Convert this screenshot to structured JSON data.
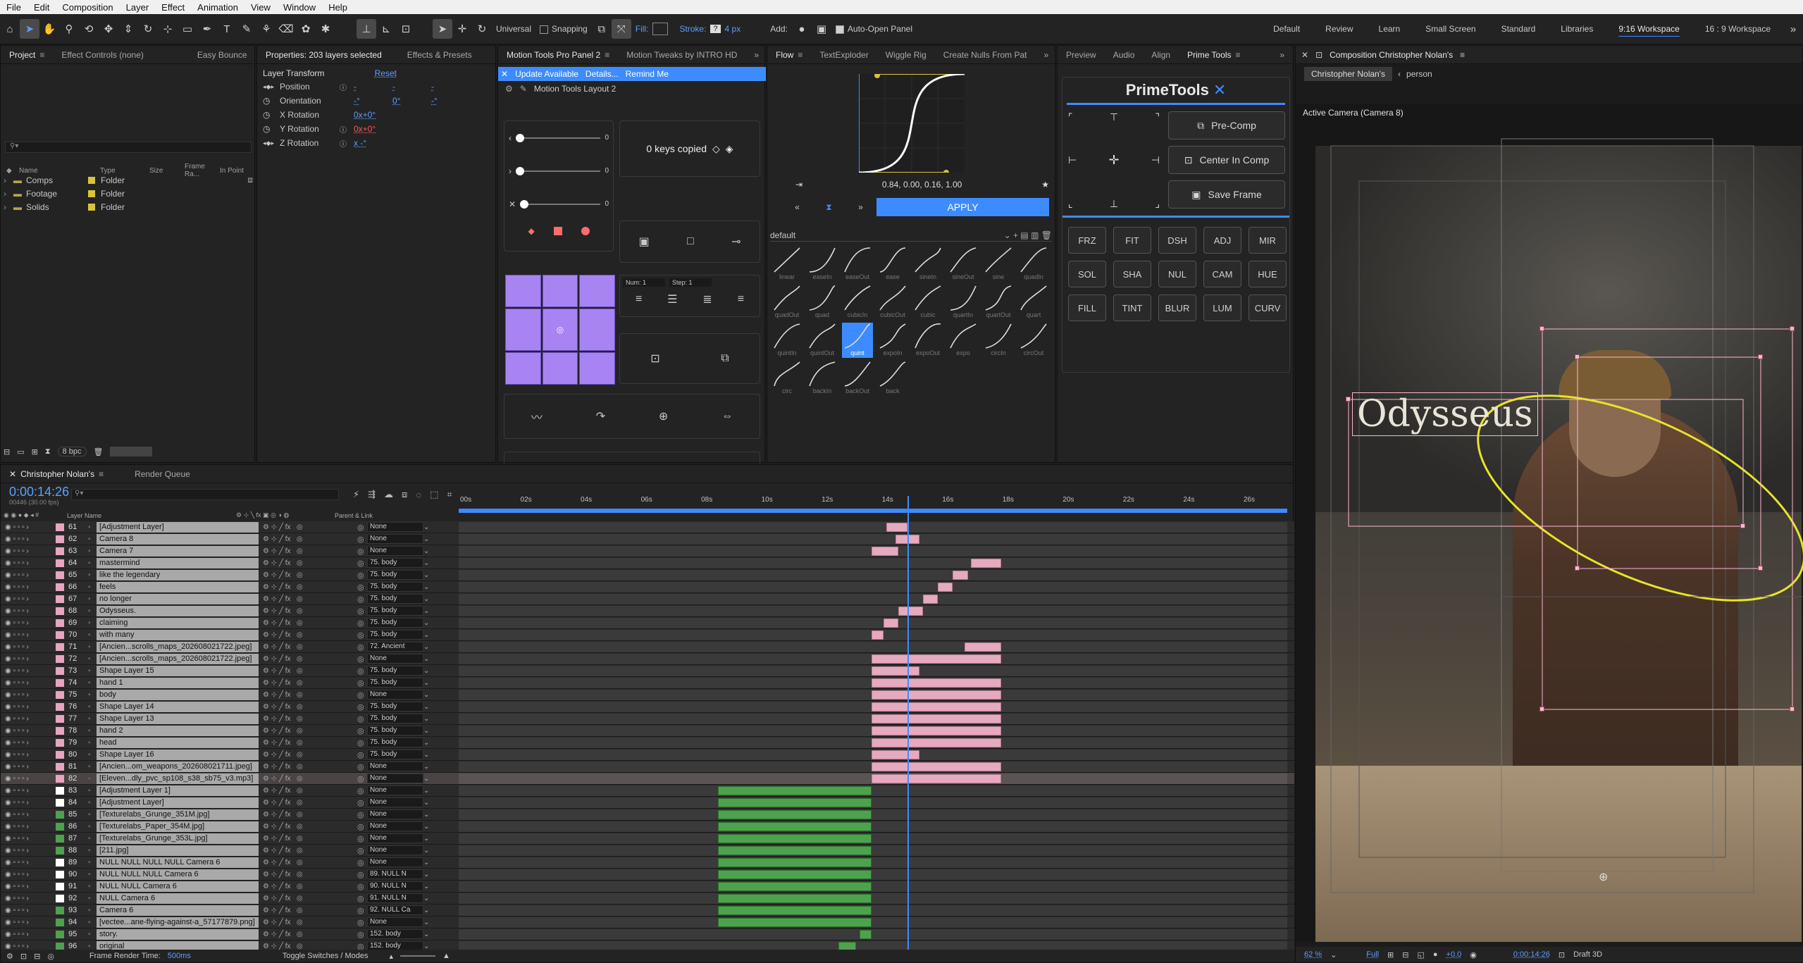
{
  "menu": [
    "File",
    "Edit",
    "Composition",
    "Layer",
    "Effect",
    "Animation",
    "View",
    "Window",
    "Help"
  ],
  "toolbar": {
    "universal": "Universal",
    "snapping": "Snapping",
    "fill": "Fill:",
    "stroke": "Stroke:",
    "stroke_value": "?",
    "stroke_px": "4 px",
    "add": "Add:",
    "auto_open": "Auto-Open Panel",
    "workspaces": [
      "Default",
      "Review",
      "Learn",
      "Small Screen",
      "Standard",
      "Libraries",
      "9:16 Workspace",
      "16 : 9 Workspace"
    ],
    "active_workspace": "9:16 Workspace"
  },
  "project_panel": {
    "tabs": [
      "Project",
      "Effect Controls (none)",
      "Easy Bounce"
    ],
    "columns": [
      "Name",
      "Type",
      "Size",
      "Frame Ra...",
      "In Point"
    ],
    "items": [
      {
        "name": "Comps",
        "type": "Folder"
      },
      {
        "name": "Footage",
        "type": "Folder"
      },
      {
        "name": "Solids",
        "type": "Folder"
      }
    ],
    "bpc": "8 bpc"
  },
  "properties_panel": {
    "tabs": [
      "Properties: 203 layers selected",
      "Effects & Presets"
    ],
    "section": "Layer Transform",
    "reset": "Reset",
    "rows": [
      {
        "label": "Position",
        "values": [
          "-",
          "-",
          "-"
        ]
      },
      {
        "label": "Orientation",
        "values": [
          "-°",
          "0°",
          "-°"
        ]
      },
      {
        "label": "X Rotation",
        "values": [
          "0x+0°"
        ]
      },
      {
        "label": "Y Rotation",
        "values": [
          "0x+0°"
        ]
      },
      {
        "label": "Z Rotation",
        "values": [
          "x -°"
        ]
      }
    ]
  },
  "motion_tools": {
    "tabs": [
      "Motion Tools Pro Panel 2",
      "Motion Tweaks by INTRO HD"
    ],
    "update_banner": "Update Available",
    "details": "Details...",
    "remind": "Remind Me",
    "layout_name": "Motion Tools Layout 2",
    "sliders": [
      "0",
      "0",
      "0"
    ],
    "keys_copied": "0 keys copied",
    "num_label": "Num: 1",
    "step_label": "Step: 1"
  },
  "flow": {
    "tabs": [
      "Flow",
      "TextExploder",
      "Wiggle Rig",
      "Create Nulls From Pat"
    ],
    "bezier": "0.84, 0.00, 0.16, 1.00",
    "apply": "APPLY",
    "preset": "default",
    "eases": [
      [
        "linear",
        "easeIn",
        "easeOut",
        "ease",
        "sineIn",
        "sineOut",
        "sine",
        "quadIn"
      ],
      [
        "quadOut",
        "quad",
        "cubicIn",
        "cubicOut",
        "cubic",
        "quartIn",
        "quartOut",
        "quart"
      ],
      [
        "quintIn",
        "quintOut",
        "quint",
        "expoIn",
        "expoOut",
        "expo",
        "circIn",
        "circOut"
      ],
      [
        "circ",
        "backIn",
        "backOut",
        "back"
      ]
    ],
    "selected_ease": "quint"
  },
  "primetools": {
    "tabs": [
      "Preview",
      "Audio",
      "Align",
      "Prime Tools"
    ],
    "title": "PrimeTools",
    "buttons_big": [
      "Pre-Comp",
      "Center In Comp",
      "Save Frame"
    ],
    "grid": [
      [
        "FRZ",
        "FIT",
        "DSH",
        "ADJ",
        "MIR"
      ],
      [
        "SOL",
        "SHA",
        "NUL",
        "CAM",
        "HUE"
      ],
      [
        "FILL",
        "TINT",
        "BLUR",
        "LUM",
        "CURV"
      ]
    ]
  },
  "composition": {
    "tab": "Composition Christopher Nolan's",
    "breadcrumb_comp": "Christopher Nolan's",
    "breadcrumb_layer": "person",
    "camera": "Active Camera (Camera 8)",
    "title_text": "Odysseus",
    "zoom": "62 %",
    "quality": "Full",
    "timecode": "0:00:14:26",
    "renderer": "Draft 3D",
    "exposure": "+0.0"
  },
  "timeline": {
    "tabs": [
      "Christopher Nolan's",
      "Render Queue"
    ],
    "timecode": "0:00:14:26",
    "fps": "00446 (30.00 fps)",
    "col_layer_name": "Layer Name",
    "col_parent": "Parent & Link",
    "ruler": [
      "00s",
      "02s",
      "04s",
      "06s",
      "08s",
      "10s",
      "12s",
      "14s",
      "16s",
      "18s",
      "20s",
      "22s",
      "24s",
      "26s"
    ],
    "layers": [
      {
        "num": "61",
        "name": "[Adjustment Layer]",
        "parent": "None",
        "color": "#e8a5c0",
        "bar": [
          14.2,
          14.9
        ],
        "barColor": "pink"
      },
      {
        "num": "62",
        "name": "Camera 8",
        "parent": "None",
        "color": "#e8a5c0",
        "bar": [
          14.5,
          15.3
        ],
        "barColor": "pink"
      },
      {
        "num": "63",
        "name": "Camera 7",
        "parent": "None",
        "color": "#e8a5c0",
        "bar": [
          13.7,
          14.6
        ],
        "barColor": "pink"
      },
      {
        "num": "64",
        "name": "mastermind",
        "parent": "75. body",
        "color": "#e8a5c0",
        "bar": [
          17.0,
          18.0
        ],
        "barColor": "pink"
      },
      {
        "num": "65",
        "name": "like the legendary",
        "parent": "75. body",
        "color": "#e8a5c0",
        "bar": [
          16.4,
          16.9
        ],
        "barColor": "pink"
      },
      {
        "num": "66",
        "name": "feels",
        "parent": "75. body",
        "color": "#e8a5c0",
        "bar": [
          15.9,
          16.4
        ],
        "barColor": "pink"
      },
      {
        "num": "67",
        "name": "no longer",
        "parent": "75. body",
        "color": "#e8a5c0",
        "bar": [
          15.4,
          15.9
        ],
        "barColor": "pink"
      },
      {
        "num": "68",
        "name": "Odysseus.",
        "parent": "75. body",
        "color": "#e8a5c0",
        "bar": [
          14.6,
          15.4
        ],
        "barColor": "pink"
      },
      {
        "num": "69",
        "name": "claiming",
        "parent": "75. body",
        "color": "#e8a5c0",
        "bar": [
          14.1,
          14.6
        ],
        "barColor": "pink"
      },
      {
        "num": "70",
        "name": "with many",
        "parent": "75. body",
        "color": "#e8a5c0",
        "bar": [
          13.7,
          14.1
        ],
        "barColor": "pink"
      },
      {
        "num": "71",
        "name": "[Ancien...scrolls_maps_202608021722.jpeg]",
        "parent": "72. Ancient",
        "color": "#e8a5c0",
        "bar": [
          16.8,
          18.0
        ],
        "barColor": "pink"
      },
      {
        "num": "72",
        "name": "[Ancien...scrolls_maps_202608021722.jpeg]",
        "parent": "None",
        "color": "#e8a5c0",
        "bar": [
          13.7,
          18.0
        ],
        "barColor": "pink"
      },
      {
        "num": "73",
        "name": "Shape Layer 15",
        "parent": "75. body",
        "color": "#e8a5c0",
        "bar": [
          13.7,
          15.3
        ],
        "barColor": "pink"
      },
      {
        "num": "74",
        "name": "hand 1",
        "parent": "75. body",
        "color": "#e8a5c0",
        "bar": [
          13.7,
          18.0
        ],
        "barColor": "pink"
      },
      {
        "num": "75",
        "name": "body",
        "parent": "None",
        "color": "#e8a5c0",
        "bar": [
          13.7,
          18.0
        ],
        "barColor": "pink"
      },
      {
        "num": "76",
        "name": "Shape Layer 14",
        "parent": "75. body",
        "color": "#e8a5c0",
        "bar": [
          13.7,
          18.0
        ],
        "barColor": "pink"
      },
      {
        "num": "77",
        "name": "Shape Layer 13",
        "parent": "75. body",
        "color": "#e8a5c0",
        "bar": [
          13.7,
          18.0
        ],
        "barColor": "pink"
      },
      {
        "num": "78",
        "name": "hand 2",
        "parent": "75. body",
        "color": "#e8a5c0",
        "bar": [
          13.7,
          18.0
        ],
        "barColor": "pink"
      },
      {
        "num": "79",
        "name": "head",
        "parent": "75. body",
        "color": "#e8a5c0",
        "bar": [
          13.7,
          18.0
        ],
        "barColor": "pink"
      },
      {
        "num": "80",
        "name": "Shape Layer 16",
        "parent": "75. body",
        "color": "#e8a5c0",
        "bar": [
          13.7,
          15.3
        ],
        "barColor": "pink"
      },
      {
        "num": "81",
        "name": "[Ancien...om_weapons_202608021711.jpeg]",
        "parent": "None",
        "color": "#e8a5c0",
        "bar": [
          13.7,
          18.0
        ],
        "barColor": "pink"
      },
      {
        "num": "82",
        "name": "[Eleven...dly_pvc_sp108_s38_sb75_v3.mp3]",
        "parent": "None",
        "color": "#e8a5c0",
        "bar": [
          13.7,
          18.0
        ],
        "barColor": "pink"
      },
      {
        "num": "83",
        "name": "[Adjustment Layer 1]",
        "parent": "None",
        "color": "#ffffff",
        "bar": [
          8.6,
          13.7
        ],
        "barColor": "green"
      },
      {
        "num": "84",
        "name": "[Adjustment Layer]",
        "parent": "None",
        "color": "#ffffff",
        "bar": [
          8.6,
          13.7
        ],
        "barColor": "green"
      },
      {
        "num": "85",
        "name": "[Texturelabs_Grunge_351M.jpg]",
        "parent": "None",
        "color": "#4ea24e",
        "bar": [
          8.6,
          13.7
        ],
        "barColor": "green"
      },
      {
        "num": "86",
        "name": "[Texturelabs_Paper_354M.jpg]",
        "parent": "None",
        "color": "#4ea24e",
        "bar": [
          8.6,
          13.7
        ],
        "barColor": "green"
      },
      {
        "num": "87",
        "name": "[Texturelabs_Grunge_353L.jpg]",
        "parent": "None",
        "color": "#4ea24e",
        "bar": [
          8.6,
          13.7
        ],
        "barColor": "green"
      },
      {
        "num": "88",
        "name": "[211.jpg]",
        "parent": "None",
        "color": "#4ea24e",
        "bar": [
          8.6,
          13.7
        ],
        "barColor": "green"
      },
      {
        "num": "89",
        "name": "NULL NULL NULL NULL Camera 6",
        "parent": "None",
        "color": "#ffffff",
        "bar": [
          8.6,
          13.7
        ],
        "barColor": "green"
      },
      {
        "num": "90",
        "name": "NULL NULL NULL Camera 6",
        "parent": "89. NULL N",
        "color": "#ffffff",
        "bar": [
          8.6,
          13.7
        ],
        "barColor": "green"
      },
      {
        "num": "91",
        "name": "NULL NULL Camera 6",
        "parent": "90. NULL N",
        "color": "#ffffff",
        "bar": [
          8.6,
          13.7
        ],
        "barColor": "green"
      },
      {
        "num": "92",
        "name": "NULL Camera 6",
        "parent": "91. NULL N",
        "color": "#ffffff",
        "bar": [
          8.6,
          13.7
        ],
        "barColor": "green"
      },
      {
        "num": "93",
        "name": "Camera 6",
        "parent": "92. NULL Ca",
        "color": "#4ea24e",
        "bar": [
          8.6,
          13.7
        ],
        "barColor": "green"
      },
      {
        "num": "94",
        "name": "[vectee...ane-flying-against-a_57177879.png]",
        "parent": "None",
        "color": "#4ea24e",
        "bar": [
          8.6,
          13.7
        ],
        "barColor": "green"
      },
      {
        "num": "95",
        "name": "story.",
        "parent": "152. body",
        "color": "#4ea24e",
        "bar": [
          13.3,
          13.7
        ],
        "barColor": "green"
      },
      {
        "num": "96",
        "name": "original",
        "parent": "152. body",
        "color": "#4ea24e",
        "bar": [
          12.6,
          13.2
        ],
        "barColor": "green"
      }
    ],
    "footer_render": "Frame Render Time:",
    "footer_render_value": "500ms",
    "footer_toggle": "Toggle Switches / Modes"
  }
}
